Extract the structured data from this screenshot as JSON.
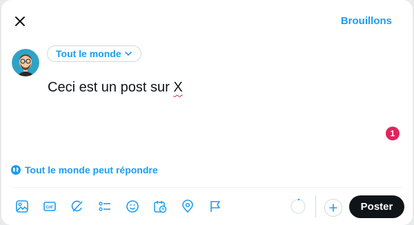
{
  "header": {
    "close_icon": "close-icon",
    "drafts_label": "Brouillons"
  },
  "composer": {
    "avatar": "user-avatar",
    "audience_label": "Tout le monde",
    "text_before": "Ceci est un post sur ",
    "text_flagged": "X",
    "notification_count": "1"
  },
  "reply_settings": {
    "icon": "globe-icon",
    "label": "Tout le monde peut répondre"
  },
  "toolbar": {
    "items": [
      "media-icon",
      "gif-icon",
      "grok-icon",
      "poll-icon",
      "emoji-icon",
      "schedule-icon",
      "location-icon",
      "flag-icon"
    ],
    "gif_text": "GIF"
  },
  "actions": {
    "post_label": "Poster"
  },
  "colors": {
    "accent": "#1d9bf0",
    "badge": "#e0245e",
    "post_button": "#0f1419"
  }
}
